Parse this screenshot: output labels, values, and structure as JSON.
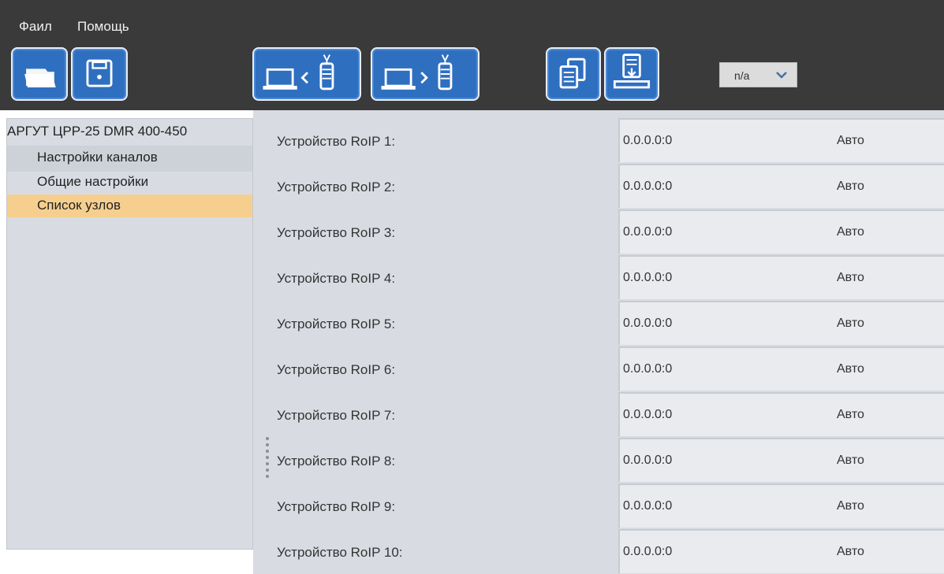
{
  "menu": {
    "file": "Фаил",
    "help": "Помощь"
  },
  "toolbar": {
    "buttons": [
      {
        "icon": "open-folder-icon"
      },
      {
        "icon": "save-disk-icon"
      },
      {
        "icon": "read-from-device-icon"
      },
      {
        "icon": "write-to-device-icon"
      },
      {
        "icon": "copy-documents-icon"
      },
      {
        "icon": "firmware-download-icon"
      }
    ],
    "selector_value": "n/a"
  },
  "tree": {
    "root": "АРГУТ ЦРР-25 DMR 400-450",
    "items": [
      {
        "label": "Настройки каналов",
        "state": "hover"
      },
      {
        "label": "Общие настройки",
        "state": "normal"
      },
      {
        "label": "Список узлов",
        "state": "selected"
      }
    ]
  },
  "rows": [
    {
      "label": "Устройство RoIP 1:",
      "address": "0.0.0.0:0",
      "mode": "Авто"
    },
    {
      "label": "Устройство RoIP 2:",
      "address": "0.0.0.0:0",
      "mode": "Авто"
    },
    {
      "label": "Устройство RoIP 3:",
      "address": "0.0.0.0:0",
      "mode": "Авто"
    },
    {
      "label": "Устройство RoIP 4:",
      "address": "0.0.0.0:0",
      "mode": "Авто"
    },
    {
      "label": "Устройство RoIP 5:",
      "address": "0.0.0.0:0",
      "mode": "Авто"
    },
    {
      "label": "Устройство RoIP 6:",
      "address": "0.0.0.0:0",
      "mode": "Авто"
    },
    {
      "label": "Устройство RoIP 7:",
      "address": "0.0.0.0:0",
      "mode": "Авто"
    },
    {
      "label": "Устройство RoIP 8:",
      "address": "0.0.0.0:0",
      "mode": "Авто"
    },
    {
      "label": "Устройство RoIP 9:",
      "address": "0.0.0.0:0",
      "mode": "Авто"
    },
    {
      "label": "Устройство RoIP 10:",
      "address": "0.0.0.0:0",
      "mode": "Авто"
    }
  ],
  "colors": {
    "toolbar_bg": "#3a3a3a",
    "button_blue": "#2f6fc0",
    "selected_item": "#f6cf8f",
    "panel_bg": "#d8dce2"
  }
}
